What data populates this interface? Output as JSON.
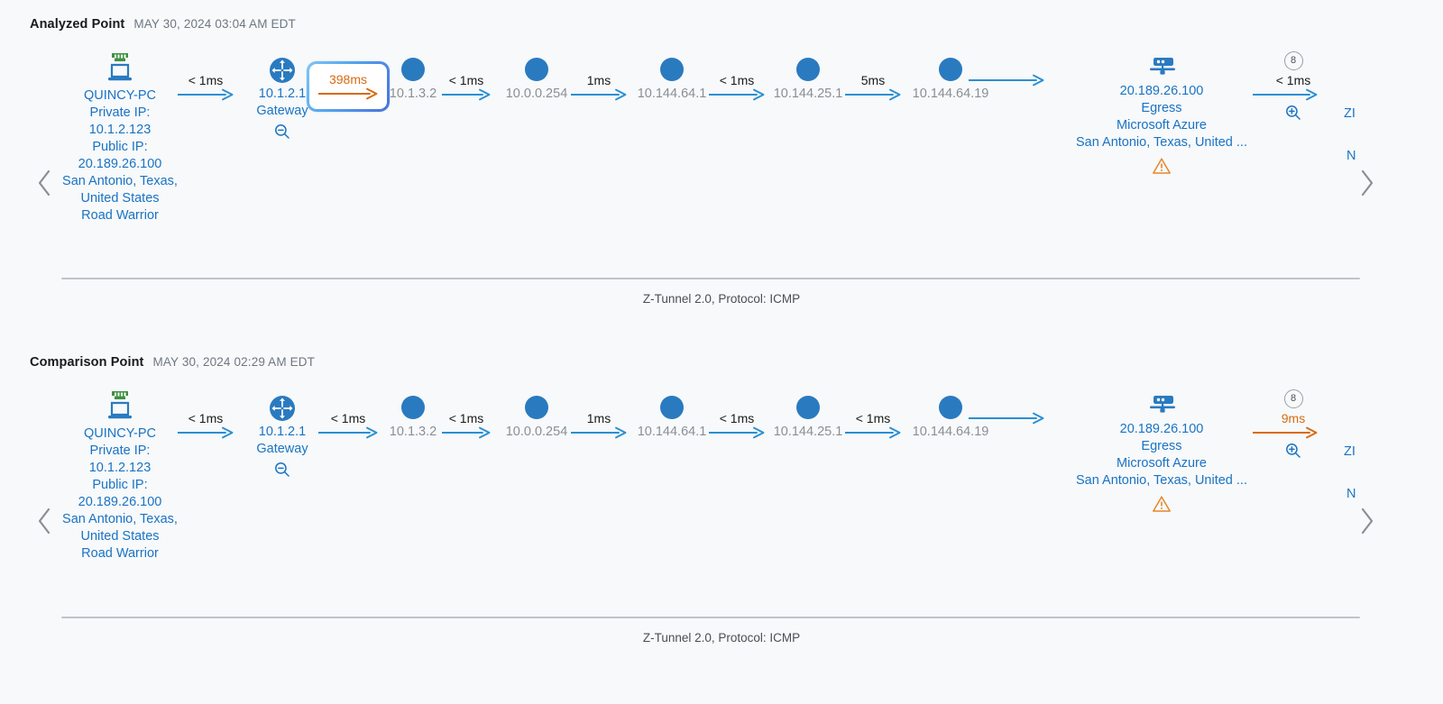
{
  "colors": {
    "background": "#f7f9fa",
    "link_blue": "#2a8fd4",
    "node_blue": "#1a73c4",
    "hop_gray": "#8a8f96",
    "accent_orange": "#d86a11",
    "warning_orange": "#e8862a",
    "divider": "#bfc4c9"
  },
  "sections": [
    {
      "id": "analyzed",
      "title": "Analyzed Point",
      "timestamp": "MAY 30, 2024 03:04 AM EDT",
      "footer": "Z-Tunnel 2.0, Protocol: ICMP",
      "prev_nav_icon": "chevron-left-icon",
      "next_nav_icon": "chevron-right-icon",
      "endpoint": {
        "icon": "laptop-ethernet-icon",
        "lines": [
          "QUINCY-PC",
          "Private IP:",
          "10.1.2.123",
          "Public IP:",
          "20.189.26.100",
          "San Antonio, Texas, United States",
          "Road Warrior"
        ]
      },
      "gateway": {
        "icon": "router-icon",
        "lines": [
          "10.1.2.1",
          "Gateway"
        ],
        "magnifier": "zoom-out-icon"
      },
      "links": [
        {
          "label": "< 1ms",
          "highlighted": false,
          "color": "blue"
        },
        {
          "label": "398ms",
          "highlighted": true,
          "color": "orange"
        },
        {
          "label": "< 1ms",
          "highlighted": false,
          "color": "blue"
        },
        {
          "label": "1ms",
          "highlighted": false,
          "color": "blue"
        },
        {
          "label": "< 1ms",
          "highlighted": false,
          "color": "blue"
        },
        {
          "label": "5ms",
          "highlighted": false,
          "color": "blue"
        },
        {
          "label": "",
          "highlighted": false,
          "color": "blue"
        }
      ],
      "hops": [
        "10.1.3.2",
        "10.0.0.254",
        "10.144.64.1",
        "10.144.25.1",
        "10.144.64.19"
      ],
      "egress": {
        "icon": "server-icon",
        "lines": [
          "20.189.26.100",
          "Egress",
          "Microsoft Azure",
          "San Antonio, Texas, United ..."
        ],
        "warning_icon": "warning-triangle-icon"
      },
      "final_link": {
        "badge": "8",
        "label": "< 1ms",
        "color": "blue",
        "magnifier": "zoom-in-icon"
      },
      "edge_labels": [
        "ZI",
        "N"
      ]
    },
    {
      "id": "comparison",
      "title": "Comparison Point",
      "timestamp": "MAY 30, 2024 02:29 AM EDT",
      "footer": "Z-Tunnel 2.0, Protocol: ICMP",
      "prev_nav_icon": "chevron-left-icon",
      "next_nav_icon": "chevron-right-icon",
      "endpoint": {
        "icon": "laptop-ethernet-icon",
        "lines": [
          "QUINCY-PC",
          "Private IP:",
          "10.1.2.123",
          "Public IP:",
          "20.189.26.100",
          "San Antonio, Texas, United States",
          "Road Warrior"
        ]
      },
      "gateway": {
        "icon": "router-icon",
        "lines": [
          "10.1.2.1",
          "Gateway"
        ],
        "magnifier": "zoom-out-icon"
      },
      "links": [
        {
          "label": "< 1ms",
          "highlighted": false,
          "color": "blue"
        },
        {
          "label": "< 1ms",
          "highlighted": false,
          "color": "blue"
        },
        {
          "label": "< 1ms",
          "highlighted": false,
          "color": "blue"
        },
        {
          "label": "1ms",
          "highlighted": false,
          "color": "blue"
        },
        {
          "label": "< 1ms",
          "highlighted": false,
          "color": "blue"
        },
        {
          "label": "< 1ms",
          "highlighted": false,
          "color": "blue"
        },
        {
          "label": "",
          "highlighted": false,
          "color": "blue"
        }
      ],
      "hops": [
        "10.1.3.2",
        "10.0.0.254",
        "10.144.64.1",
        "10.144.25.1",
        "10.144.64.19"
      ],
      "egress": {
        "icon": "server-icon",
        "lines": [
          "20.189.26.100",
          "Egress",
          "Microsoft Azure",
          "San Antonio, Texas, United ..."
        ],
        "warning_icon": "warning-triangle-icon"
      },
      "final_link": {
        "badge": "8",
        "label": "9ms",
        "color": "orange",
        "magnifier": "zoom-in-icon"
      },
      "edge_labels": [
        "ZI",
        "N"
      ]
    }
  ]
}
